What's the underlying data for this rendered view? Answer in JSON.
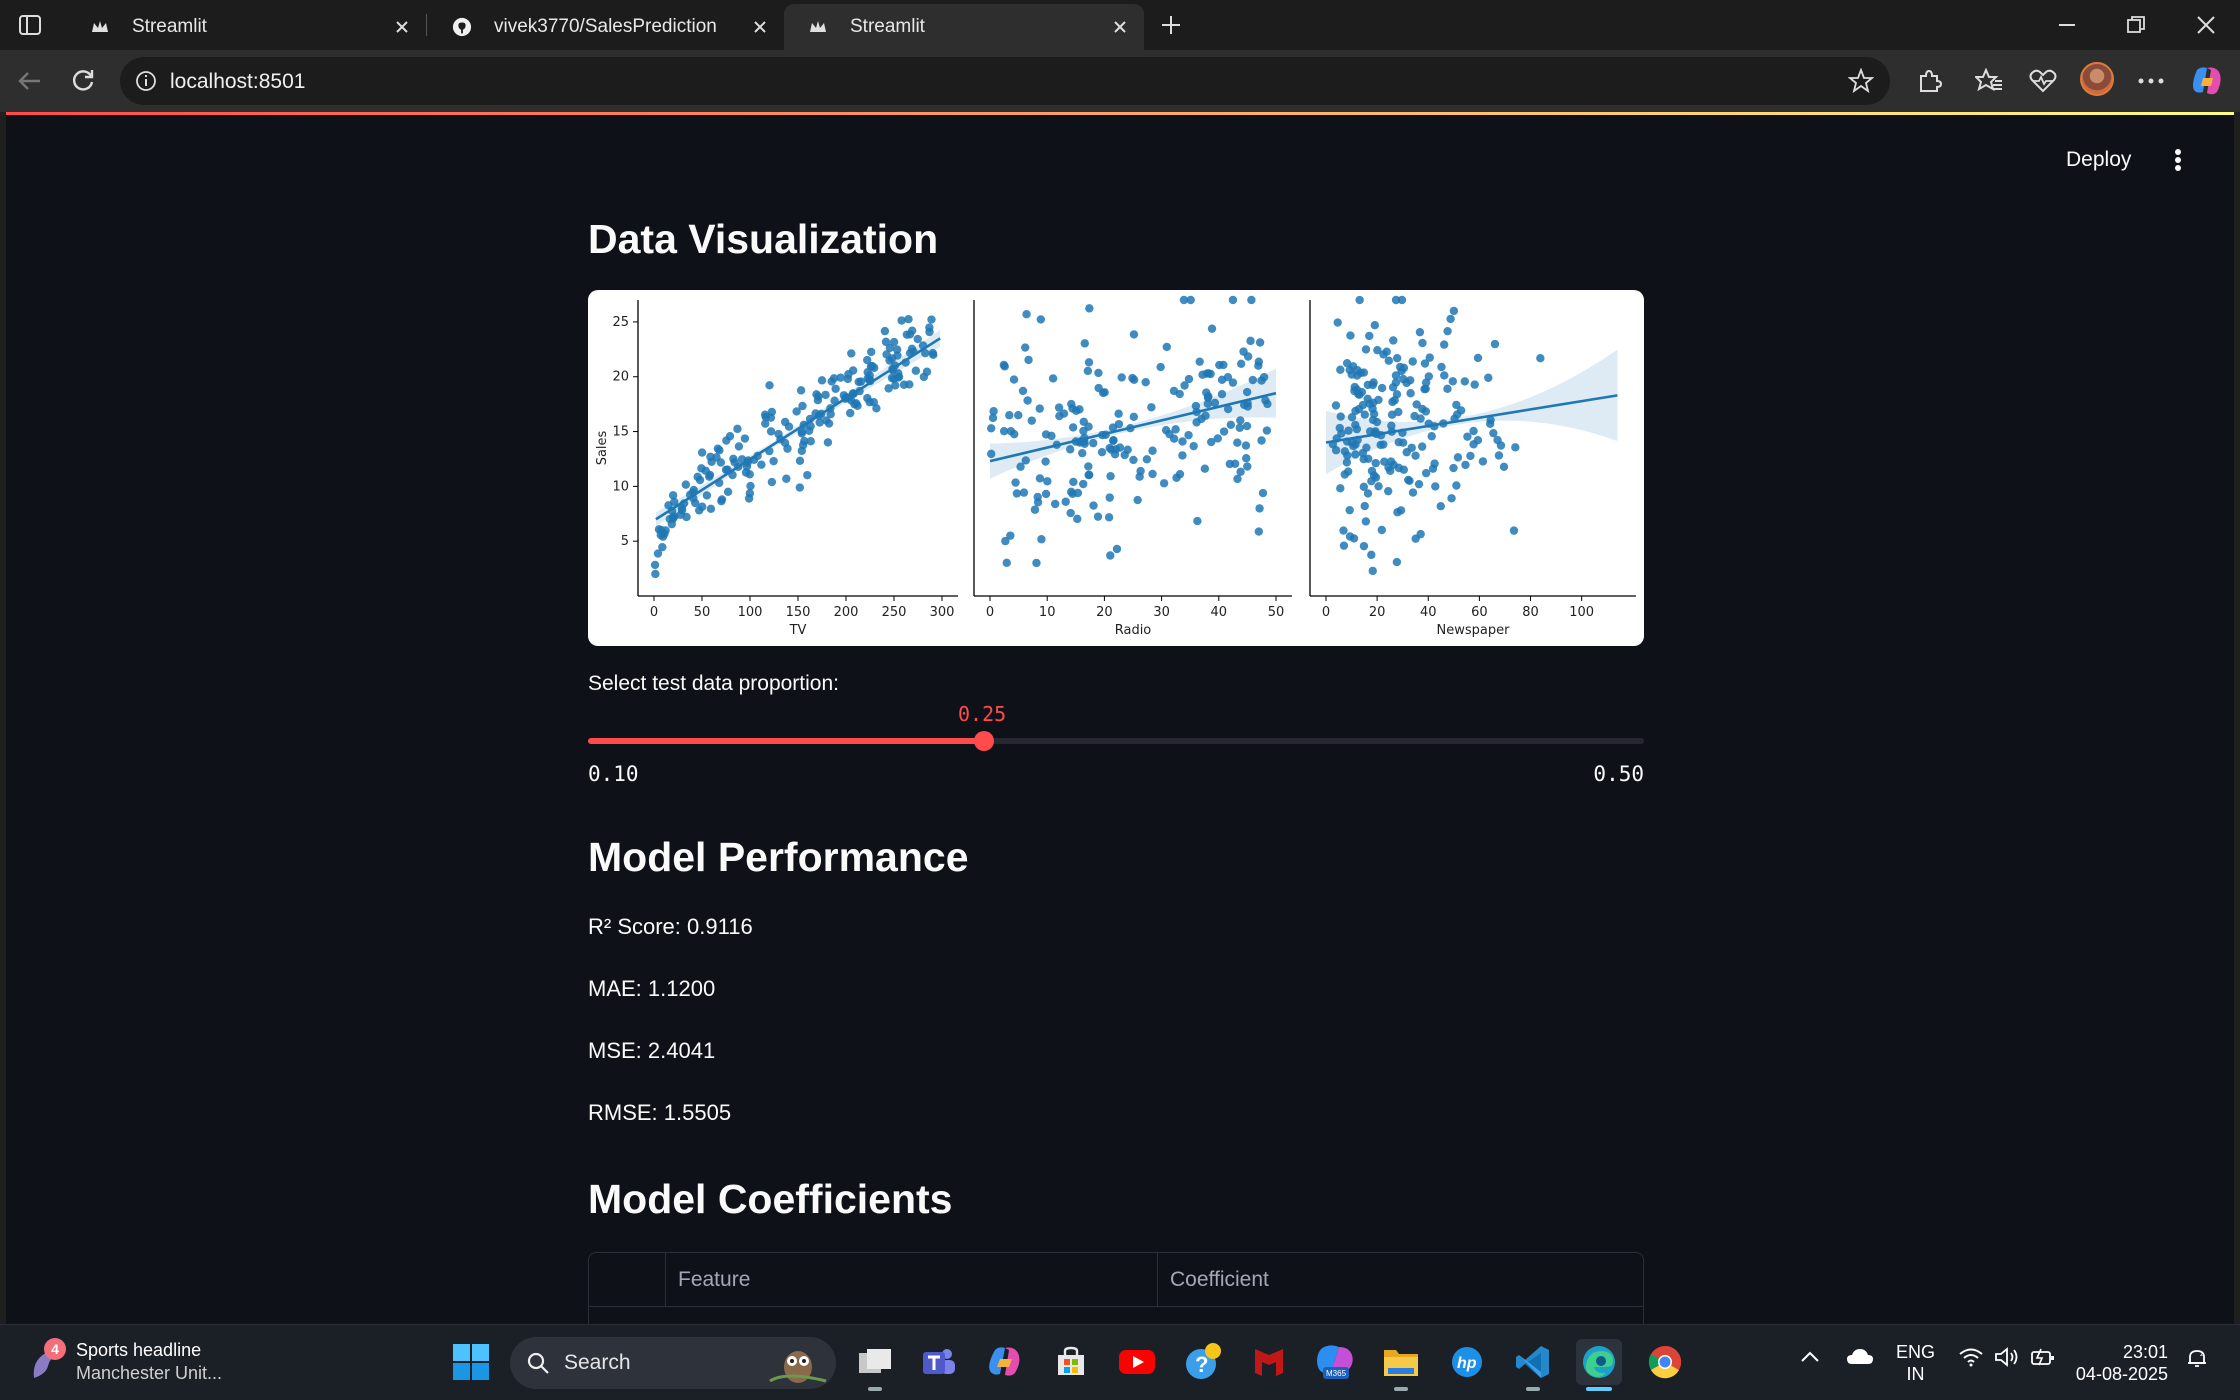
{
  "browser": {
    "tabs": [
      {
        "title": "Streamlit",
        "favicon": "streamlit-crown-icon"
      },
      {
        "title": "vivek3770/SalesPrediction",
        "favicon": "github-icon"
      },
      {
        "title": "Streamlit",
        "favicon": "streamlit-crown-icon",
        "active": true
      }
    ],
    "url": "localhost:8501"
  },
  "app": {
    "header": {
      "deploy_label": "Deploy"
    },
    "sections": {
      "viz_title": "Data Visualization",
      "perf_title": "Model Performance",
      "coef_title": "Model Coefficients"
    },
    "slider": {
      "label": "Select test data proportion:",
      "value": 0.25,
      "value_label": "0.25",
      "min_label": "0.10",
      "max_label": "0.50",
      "min": 0.1,
      "max": 0.5,
      "accent": "#ff4b4b"
    },
    "metrics": {
      "r2": "R² Score: 0.9116",
      "mae": "MAE: 1.1200",
      "mse": "MSE: 2.4041",
      "rmse": "RMSE: 1.5505"
    },
    "table": {
      "columns": [
        "",
        "Feature",
        "Coefficient"
      ]
    }
  },
  "chart_data": [
    {
      "type": "scatter",
      "xlabel": "TV",
      "ylabel": "Sales",
      "xlim": [
        0,
        300
      ],
      "ylim": [
        0,
        27
      ],
      "xticks": [
        0,
        50,
        100,
        150,
        200,
        250,
        300
      ],
      "yticks": [
        5,
        10,
        15,
        20,
        25
      ],
      "regression": {
        "x0": 2,
        "y0": 7.0,
        "x1": 298,
        "y1": 23.5
      },
      "color": "#1f77b4"
    },
    {
      "type": "scatter",
      "xlabel": "Radio",
      "ylabel": "",
      "xlim": [
        0,
        50
      ],
      "ylim": [
        0,
        27
      ],
      "xticks": [
        0,
        10,
        20,
        30,
        40,
        50
      ],
      "regression": {
        "x0": 0,
        "y0": 12.3,
        "x1": 50,
        "y1": 18.5
      },
      "color": "#1f77b4"
    },
    {
      "type": "scatter",
      "xlabel": "Newspaper",
      "ylabel": "",
      "xlim": [
        0,
        115
      ],
      "ylim": [
        0,
        27
      ],
      "xticks": [
        0,
        20,
        40,
        60,
        80,
        100
      ],
      "regression": {
        "x0": 0,
        "y0": 14.0,
        "x1": 114,
        "y1": 18.3
      },
      "color": "#1f77b4"
    }
  ],
  "taskbar": {
    "weather_title": "Sports headline",
    "weather_sub": "Manchester Unit...",
    "badge": "4",
    "search_placeholder": "Search",
    "lang_top": "ENG",
    "lang_bottom": "IN",
    "time": "23:01",
    "date": "04-08-2025"
  }
}
